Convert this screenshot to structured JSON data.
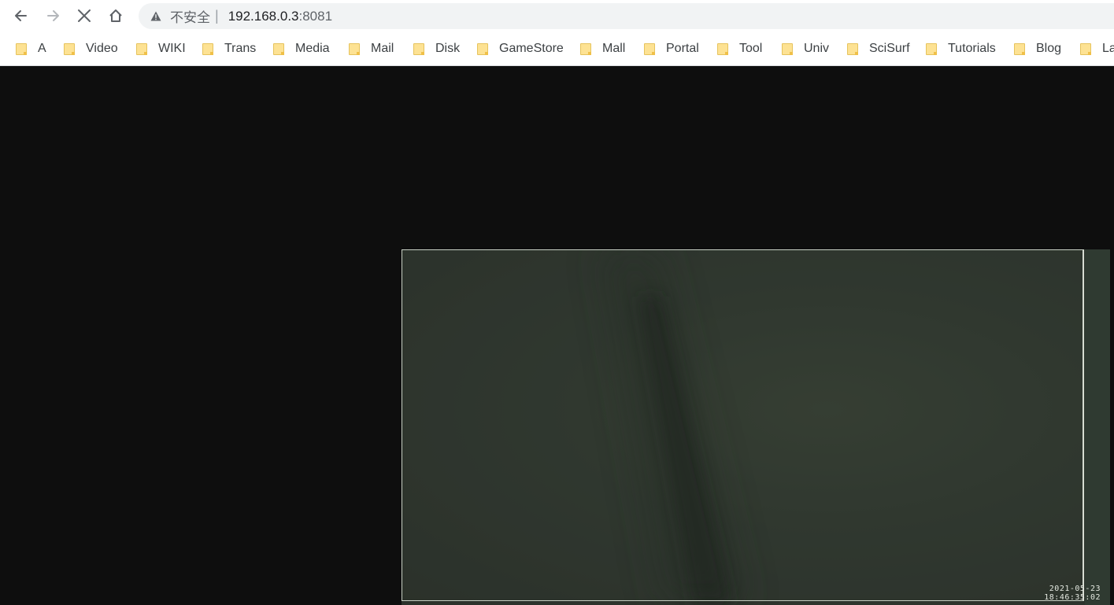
{
  "toolbar": {
    "back_icon": "arrow-left-icon",
    "forward_icon": "arrow-right-icon",
    "stop_icon": "close-icon",
    "home_icon": "home-icon"
  },
  "omnibox": {
    "security_icon": "warning-triangle-icon",
    "security_label": "不安全",
    "separator": "|",
    "url_host": "192.168.0.3",
    "url_port": ":8081"
  },
  "bookmarks": [
    {
      "label": "A",
      "icon": "folder-icon"
    },
    {
      "label": "Video",
      "icon": "folder-icon"
    },
    {
      "label": "WIKI",
      "icon": "folder-icon"
    },
    {
      "label": "Trans",
      "icon": "folder-icon"
    },
    {
      "label": "Media",
      "icon": "folder-icon"
    },
    {
      "label": "Mail",
      "icon": "folder-icon"
    },
    {
      "label": "Disk",
      "icon": "folder-icon"
    },
    {
      "label": "GameStore",
      "icon": "folder-icon"
    },
    {
      "label": "Mall",
      "icon": "folder-icon"
    },
    {
      "label": "Portal",
      "icon": "folder-icon"
    },
    {
      "label": "Tool",
      "icon": "folder-icon"
    },
    {
      "label": "Univ",
      "icon": "folder-icon"
    },
    {
      "label": "SciSurf",
      "icon": "folder-icon"
    },
    {
      "label": "Tutorials",
      "icon": "folder-icon"
    },
    {
      "label": "Blog",
      "icon": "folder-icon"
    },
    {
      "label": "La",
      "icon": "folder-icon"
    }
  ],
  "video": {
    "timestamp_date": "2021-05-23",
    "timestamp_time": "18:46:35:02"
  },
  "colors": {
    "page_background": "#0e0e0e",
    "omnibox_background": "#f1f3f4",
    "folder_yellow": "#fde293"
  }
}
